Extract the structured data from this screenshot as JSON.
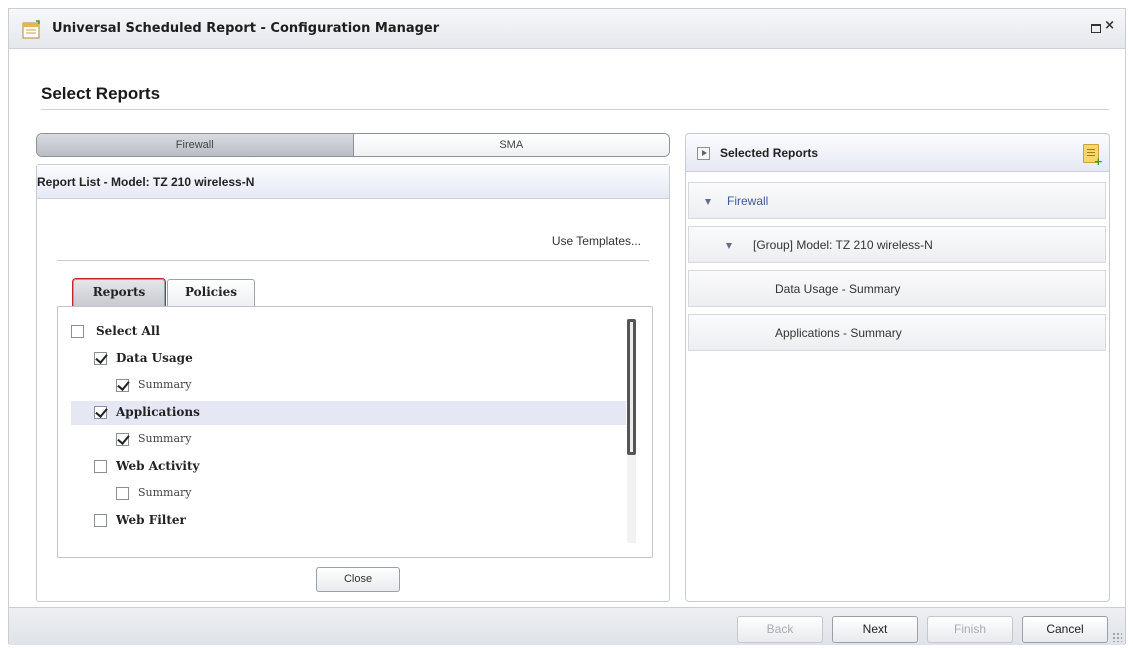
{
  "window": {
    "title": "Universal Scheduled Report - Configuration Manager",
    "icon": "report-calendar-icon"
  },
  "page": {
    "section_title": "Select Reports"
  },
  "segments": [
    {
      "label": "Firewall",
      "active": true
    },
    {
      "label": "SMA",
      "active": false
    }
  ],
  "report_list": {
    "title": "Report List - Model: TZ 210 wireless-N",
    "use_templates": "Use Templates...",
    "tabs": [
      {
        "label": "Reports",
        "active": true
      },
      {
        "label": "Policies",
        "active": false
      }
    ],
    "items": [
      {
        "label": "Select All",
        "checked": false,
        "level": 0
      },
      {
        "label": "Data Usage",
        "checked": true,
        "level": 1
      },
      {
        "label": "Summary",
        "checked": true,
        "level": 2
      },
      {
        "label": "Applications",
        "checked": true,
        "level": 1,
        "selected": true
      },
      {
        "label": "Summary",
        "checked": true,
        "level": 2
      },
      {
        "label": "Web Activity",
        "checked": false,
        "level": 1
      },
      {
        "label": "Summary",
        "checked": false,
        "level": 2
      },
      {
        "label": "Web Filter",
        "checked": false,
        "level": 1
      }
    ],
    "close_label": "Close"
  },
  "selected_reports": {
    "title": "Selected Reports",
    "tree": [
      {
        "label": "Firewall",
        "expanded": true
      },
      {
        "label": "[Group] Model: TZ 210 wireless-N",
        "expanded": true
      },
      {
        "label": "Data Usage - Summary"
      },
      {
        "label": "Applications - Summary"
      }
    ]
  },
  "footer": {
    "back": "Back",
    "next": "Next",
    "finish": "Finish",
    "cancel": "Cancel"
  },
  "colors": {
    "accent_outline": "#c0262d",
    "selection": "#e5e7f5",
    "tree_link": "#3d5b94"
  }
}
